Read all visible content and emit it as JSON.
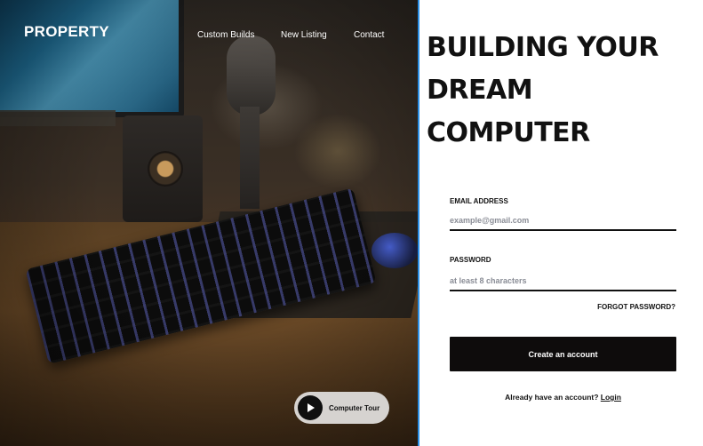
{
  "brand": "PROPERTY",
  "nav": {
    "items": [
      {
        "label": "Custom Builds"
      },
      {
        "label": "New Listing"
      },
      {
        "label": "Contact"
      }
    ]
  },
  "tour_button": {
    "label": "Computer Tour",
    "icon": "play-icon"
  },
  "headline": {
    "line1": "BUILDING YOUR",
    "line2": "DREAM COMPUTER"
  },
  "form": {
    "email": {
      "label": "EMAIL ADDRESS",
      "placeholder": "example@gmail.com",
      "value": ""
    },
    "password": {
      "label": "PASSWORD",
      "placeholder": "at least 8 characters",
      "value": ""
    },
    "forgot_label": "FORGOT PASSWORD?",
    "submit_label": "Create an account",
    "signin_prompt": "Already have an account?",
    "signin_link": "Login"
  },
  "colors": {
    "accent_divider": "#2a8fe6",
    "button_bg": "#0e0c0c",
    "text": "#111111",
    "placeholder": "#8a8d96"
  }
}
